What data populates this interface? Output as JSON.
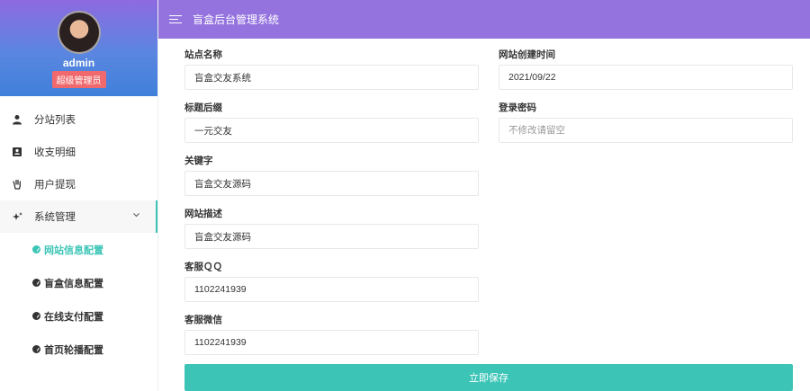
{
  "app": {
    "title": "盲盒后台管理系统"
  },
  "user": {
    "name": "admin",
    "role": "超级管理员"
  },
  "sidebar": {
    "items": [
      {
        "label": "分站列表",
        "icon": "person-icon"
      },
      {
        "label": "收支明细",
        "icon": "contact-card-icon"
      },
      {
        "label": "用户提现",
        "icon": "hand-icon"
      },
      {
        "label": "系统管理",
        "icon": "sparkle-icon",
        "expanded": true
      }
    ],
    "submenu": [
      {
        "label": "网站信息配置",
        "active": true
      },
      {
        "label": "盲盒信息配置"
      },
      {
        "label": "在线支付配置"
      },
      {
        "label": "首页轮播配置"
      }
    ]
  },
  "form": {
    "site_name": {
      "label": "站点名称",
      "value": "盲盒交友系统"
    },
    "created_time": {
      "label": "网站创建时间",
      "value": "2021/09/22"
    },
    "title_suffix": {
      "label": "标题后缀",
      "value": "一元交友"
    },
    "login_password": {
      "label": "登录密码",
      "value": "",
      "placeholder": "不修改请留空"
    },
    "keywords": {
      "label": "关键字",
      "value": "盲盒交友源码"
    },
    "description": {
      "label": "网站描述",
      "value": "盲盒交友源码"
    },
    "service_qq": {
      "label": "客服ＱＱ",
      "value": "1102241939"
    },
    "service_wechat": {
      "label": "客服微信",
      "value": "1102241939"
    },
    "save_label": "立即保存"
  },
  "colors": {
    "topbar": "#9473df",
    "accent": "#3cc5b7",
    "badge": "#f0696d"
  }
}
